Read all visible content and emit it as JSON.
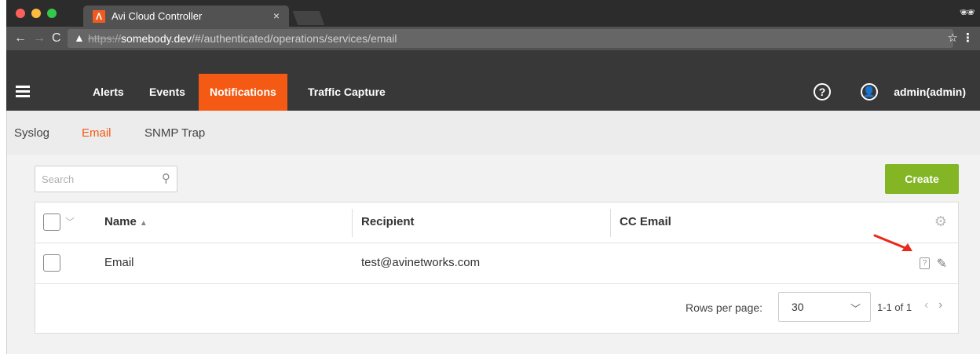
{
  "browser": {
    "tab_title": "Avi Cloud Controller",
    "tab_logo": "Λ",
    "tab_close": "×",
    "url_scheme": "https://",
    "url_host": "somebody.dev",
    "url_path": "/#/authenticated/operations/services/email"
  },
  "appnav": {
    "items": [
      "Alerts",
      "Events",
      "Notifications",
      "Traffic Capture"
    ],
    "active": "Notifications",
    "help": "?",
    "user": "admin(admin)"
  },
  "subnav": {
    "items": [
      "Syslog",
      "Email",
      "SNMP Trap"
    ],
    "active": "Email"
  },
  "toolbar": {
    "search_placeholder": "Search",
    "create_label": "Create"
  },
  "grid": {
    "columns": [
      "Name",
      "Recipient",
      "CC Email"
    ],
    "rows": [
      {
        "name": "Email",
        "recipient": "test@avinetworks.com",
        "cc": ""
      }
    ],
    "footer": {
      "rows_per_page_label": "Rows per page:",
      "rows_per_page": "30",
      "page_info": "1-1 of 1"
    }
  },
  "colors": {
    "accent": "#f45a14",
    "create": "#83b524",
    "nav_bg": "#383838",
    "annotation_arrow": "#e8291c"
  },
  "icons": [
    "search-icon",
    "gear-icon",
    "help-icon",
    "edit-icon",
    "user-icon",
    "hamburger-icon",
    "star-icon",
    "chevron-down-icon"
  ]
}
